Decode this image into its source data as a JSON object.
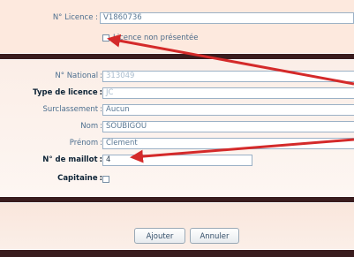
{
  "licence": {
    "number_label": "N° Licence :",
    "number_value": "V1860736",
    "not_presented_label": "Licence non présentée"
  },
  "form": {
    "national_label": "N° National",
    "national_value": "313049",
    "type_label": "Type de licence",
    "type_value": "JC",
    "surclassement_label": "Surclassement",
    "surclassement_value": "Aucun",
    "nom_label": "Nom",
    "nom_value": "SOUBIGOU",
    "prenom_label": "Prénom",
    "prenom_value": "Clement",
    "maillot_label": "N° de maillot",
    "maillot_value": "4",
    "capitaine_label": "Capitaine"
  },
  "buttons": {
    "ajouter": "Ajouter",
    "annuler": "Annuler"
  },
  "colors": {
    "annotation_arrow": "#d42a2a",
    "dark_band": "#3a1c1e"
  }
}
